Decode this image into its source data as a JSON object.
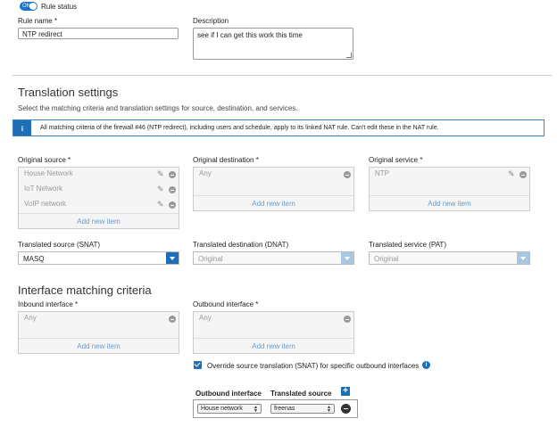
{
  "rule_status": {
    "toggle_text": "ON",
    "label": "Rule status"
  },
  "rule_name": {
    "label": "Rule name *",
    "value": "NTP redirect"
  },
  "description": {
    "label": "Description",
    "value": "see if I can get this work this time"
  },
  "translation": {
    "title": "Translation settings",
    "subtitle": "Select the matching criteria and translation settings for source, destination, and services.",
    "info_icon": "i",
    "info_text": "All matching criteria of the firewall #46 (NTP redirect), including users and schedule, apply to its linked NAT rule. Can't edit these in the NAT rule."
  },
  "original_source": {
    "label": "Original source *",
    "items": [
      "House Network",
      "IoT Network",
      "VoIP network"
    ],
    "add_new": "Add new item"
  },
  "original_destination": {
    "label": "Original destination *",
    "items": [
      "Any"
    ],
    "add_new": "Add new item"
  },
  "original_service": {
    "label": "Original service *",
    "items": [
      "NTP"
    ],
    "add_new": "Add new item"
  },
  "translated_source": {
    "label": "Translated source (SNAT)",
    "value": "MASQ"
  },
  "translated_destination": {
    "label": "Translated destination (DNAT)",
    "value": "Original"
  },
  "translated_service": {
    "label": "Translated service (PAT)",
    "value": "Original"
  },
  "interface": {
    "title": "Interface matching criteria",
    "inbound_label": "Inbound interface *",
    "inbound_items": [
      "Any"
    ],
    "outbound_label": "Outbound interface *",
    "outbound_items": [
      "Any"
    ],
    "add_new": "Add new item",
    "override_label": "Override source translation (SNAT) for specific outbound interfaces",
    "info_icon": "i"
  },
  "mapping": {
    "col_outbound": "Outbound interface",
    "col_translated": "Translated source",
    "add_icon": "+",
    "rows": [
      {
        "interface": "House network",
        "source": "freenas"
      }
    ]
  },
  "icons": {
    "pencil": "pencil-icon",
    "minus": "minus-circle-icon",
    "dropdown": "chevron-down-icon",
    "info": "info-icon",
    "plus": "plus-icon"
  },
  "colors": {
    "accent": "#1f6fb8",
    "link": "#6a9ad0",
    "muted": "#999999"
  }
}
